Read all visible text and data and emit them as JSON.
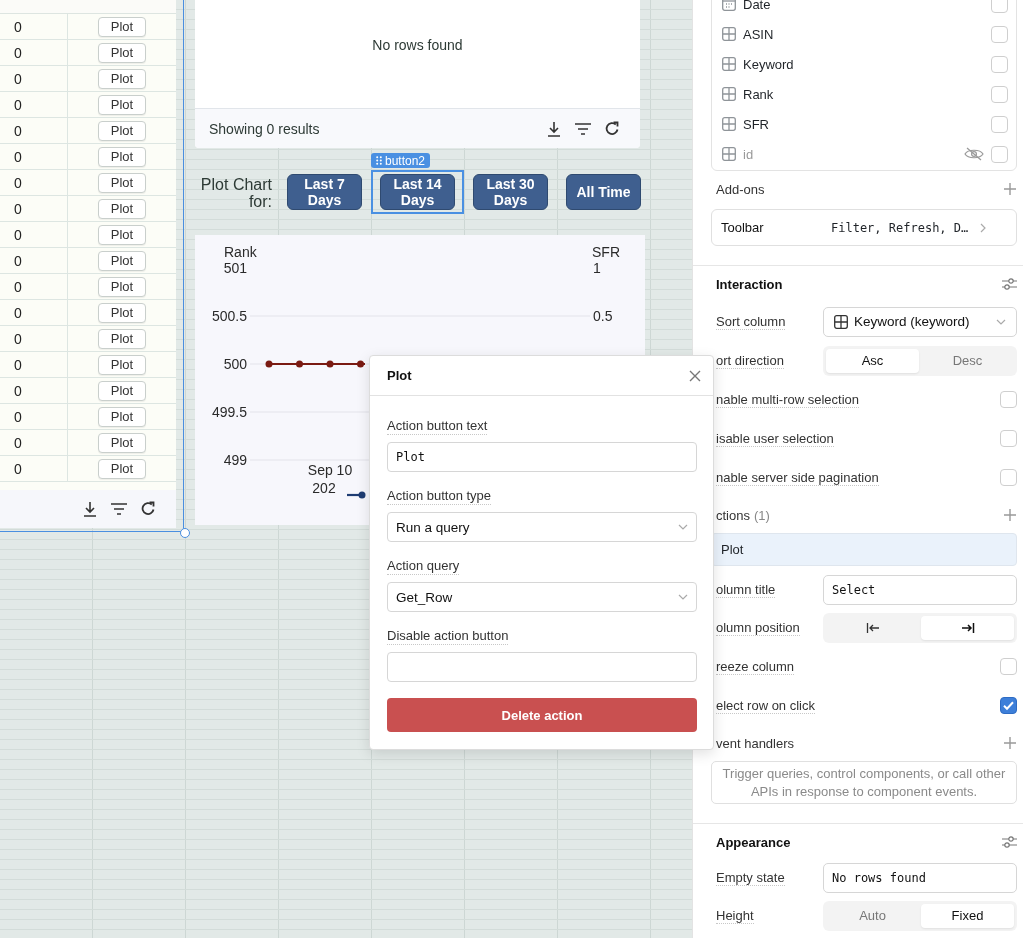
{
  "left_table": {
    "rows": [
      {
        "value": "0",
        "action": "Plot"
      },
      {
        "value": "0",
        "action": "Plot"
      },
      {
        "value": "0",
        "action": "Plot"
      },
      {
        "value": "0",
        "action": "Plot"
      },
      {
        "value": "0",
        "action": "Plot"
      },
      {
        "value": "0",
        "action": "Plot"
      },
      {
        "value": "0",
        "action": "Plot"
      },
      {
        "value": "0",
        "action": "Plot"
      },
      {
        "value": "0",
        "action": "Plot"
      },
      {
        "value": "0",
        "action": "Plot"
      },
      {
        "value": "0",
        "action": "Plot"
      },
      {
        "value": "0",
        "action": "Plot"
      },
      {
        "value": "0",
        "action": "Plot"
      },
      {
        "value": "0",
        "action": "Plot"
      },
      {
        "value": "0",
        "action": "Plot"
      },
      {
        "value": "0",
        "action": "Plot"
      },
      {
        "value": "0",
        "action": "Plot"
      },
      {
        "value": "0",
        "action": "Plot"
      }
    ]
  },
  "results_table": {
    "empty_text": "No rows found",
    "summary": "Showing 0 results"
  },
  "selection_tag": "button2",
  "range_label": "Plot Chart for:",
  "range_buttons": [
    {
      "label": "Last 7 Days",
      "selected": false
    },
    {
      "label": "Last 14 Days",
      "selected": true
    },
    {
      "label": "Last 30 Days",
      "selected": false
    },
    {
      "label": "All Time",
      "selected": false
    }
  ],
  "chart": {
    "left_axis": {
      "title": "Rank",
      "ticks": [
        "501",
        "500.5",
        "500",
        "499.5",
        "499"
      ]
    },
    "right_axis": {
      "title": "SFR",
      "ticks": [
        "1",
        "0.5"
      ]
    },
    "x_tick_label": "Sep 10\n202"
  },
  "popover": {
    "title": "Plot",
    "fields": [
      {
        "kind": "text",
        "label": "Action button text",
        "value": "Plot"
      },
      {
        "kind": "select",
        "label": "Action button type",
        "value": "Run a query"
      },
      {
        "kind": "select",
        "label": "Action query",
        "value": "Get_Row"
      },
      {
        "kind": "text",
        "label": "Disable action button"
      }
    ],
    "delete_button": "Delete action"
  },
  "panel": {
    "rows": [
      {
        "kind": "columns",
        "items": [
          {
            "kind": "date",
            "label": "Date",
            "hidden": false,
            "checked": false
          },
          {
            "kind": "text",
            "label": "ASIN",
            "hidden": false,
            "checked": false
          },
          {
            "kind": "text",
            "label": "Keyword",
            "hidden": false,
            "checked": false
          },
          {
            "kind": "text",
            "label": "Rank",
            "hidden": false,
            "checked": false
          },
          {
            "kind": "text",
            "label": "SFR",
            "hidden": false,
            "checked": false
          },
          {
            "kind": "text",
            "label": "id",
            "hidden": true,
            "checked": false
          }
        ]
      },
      {
        "kind": "header",
        "label": "Add-ons"
      },
      {
        "kind": "addon",
        "label": "Toolbar",
        "value": "Filter, Refresh, D…"
      },
      {
        "kind": "section",
        "title": "Interaction"
      },
      {
        "kind": "select",
        "label": "Sort column",
        "value": "Keyword (keyword)"
      },
      {
        "kind": "segmented",
        "label": "ort direction",
        "options": [
          {
            "label": "Asc",
            "selected": true
          },
          {
            "label": "Desc",
            "selected": false
          }
        ]
      },
      {
        "kind": "checkbox",
        "label": "nable multi-row selection",
        "checked": false
      },
      {
        "kind": "checkbox",
        "label": "isable user selection",
        "checked": false
      },
      {
        "kind": "checkbox",
        "label": "nable server side pagination",
        "checked": false
      },
      {
        "kind": "header",
        "label": "ctions",
        "count": "(1)"
      },
      {
        "kind": "item",
        "label": "Plot",
        "selected": true
      },
      {
        "kind": "input",
        "label": "olumn title",
        "value": "Select"
      },
      {
        "kind": "segmented",
        "label": "olumn position",
        "options": [
          {
            "selected": false
          },
          {
            "selected": true
          }
        ]
      },
      {
        "kind": "checkbox",
        "label": "reeze column",
        "checked": false
      },
      {
        "kind": "checkbox",
        "label": "elect row on click",
        "checked": true
      },
      {
        "kind": "header",
        "label": "vent handlers"
      },
      {
        "kind": "hint",
        "text": "Trigger queries, control components, or call other APIs in response to component events."
      },
      {
        "kind": "section",
        "title": "Appearance"
      },
      {
        "kind": "input",
        "label": "Empty state",
        "value": "No rows found"
      },
      {
        "kind": "segmented",
        "label": "Height",
        "options": [
          {
            "label": "Auto",
            "selected": false
          },
          {
            "label": "Fixed",
            "selected": true
          }
        ]
      }
    ]
  }
}
